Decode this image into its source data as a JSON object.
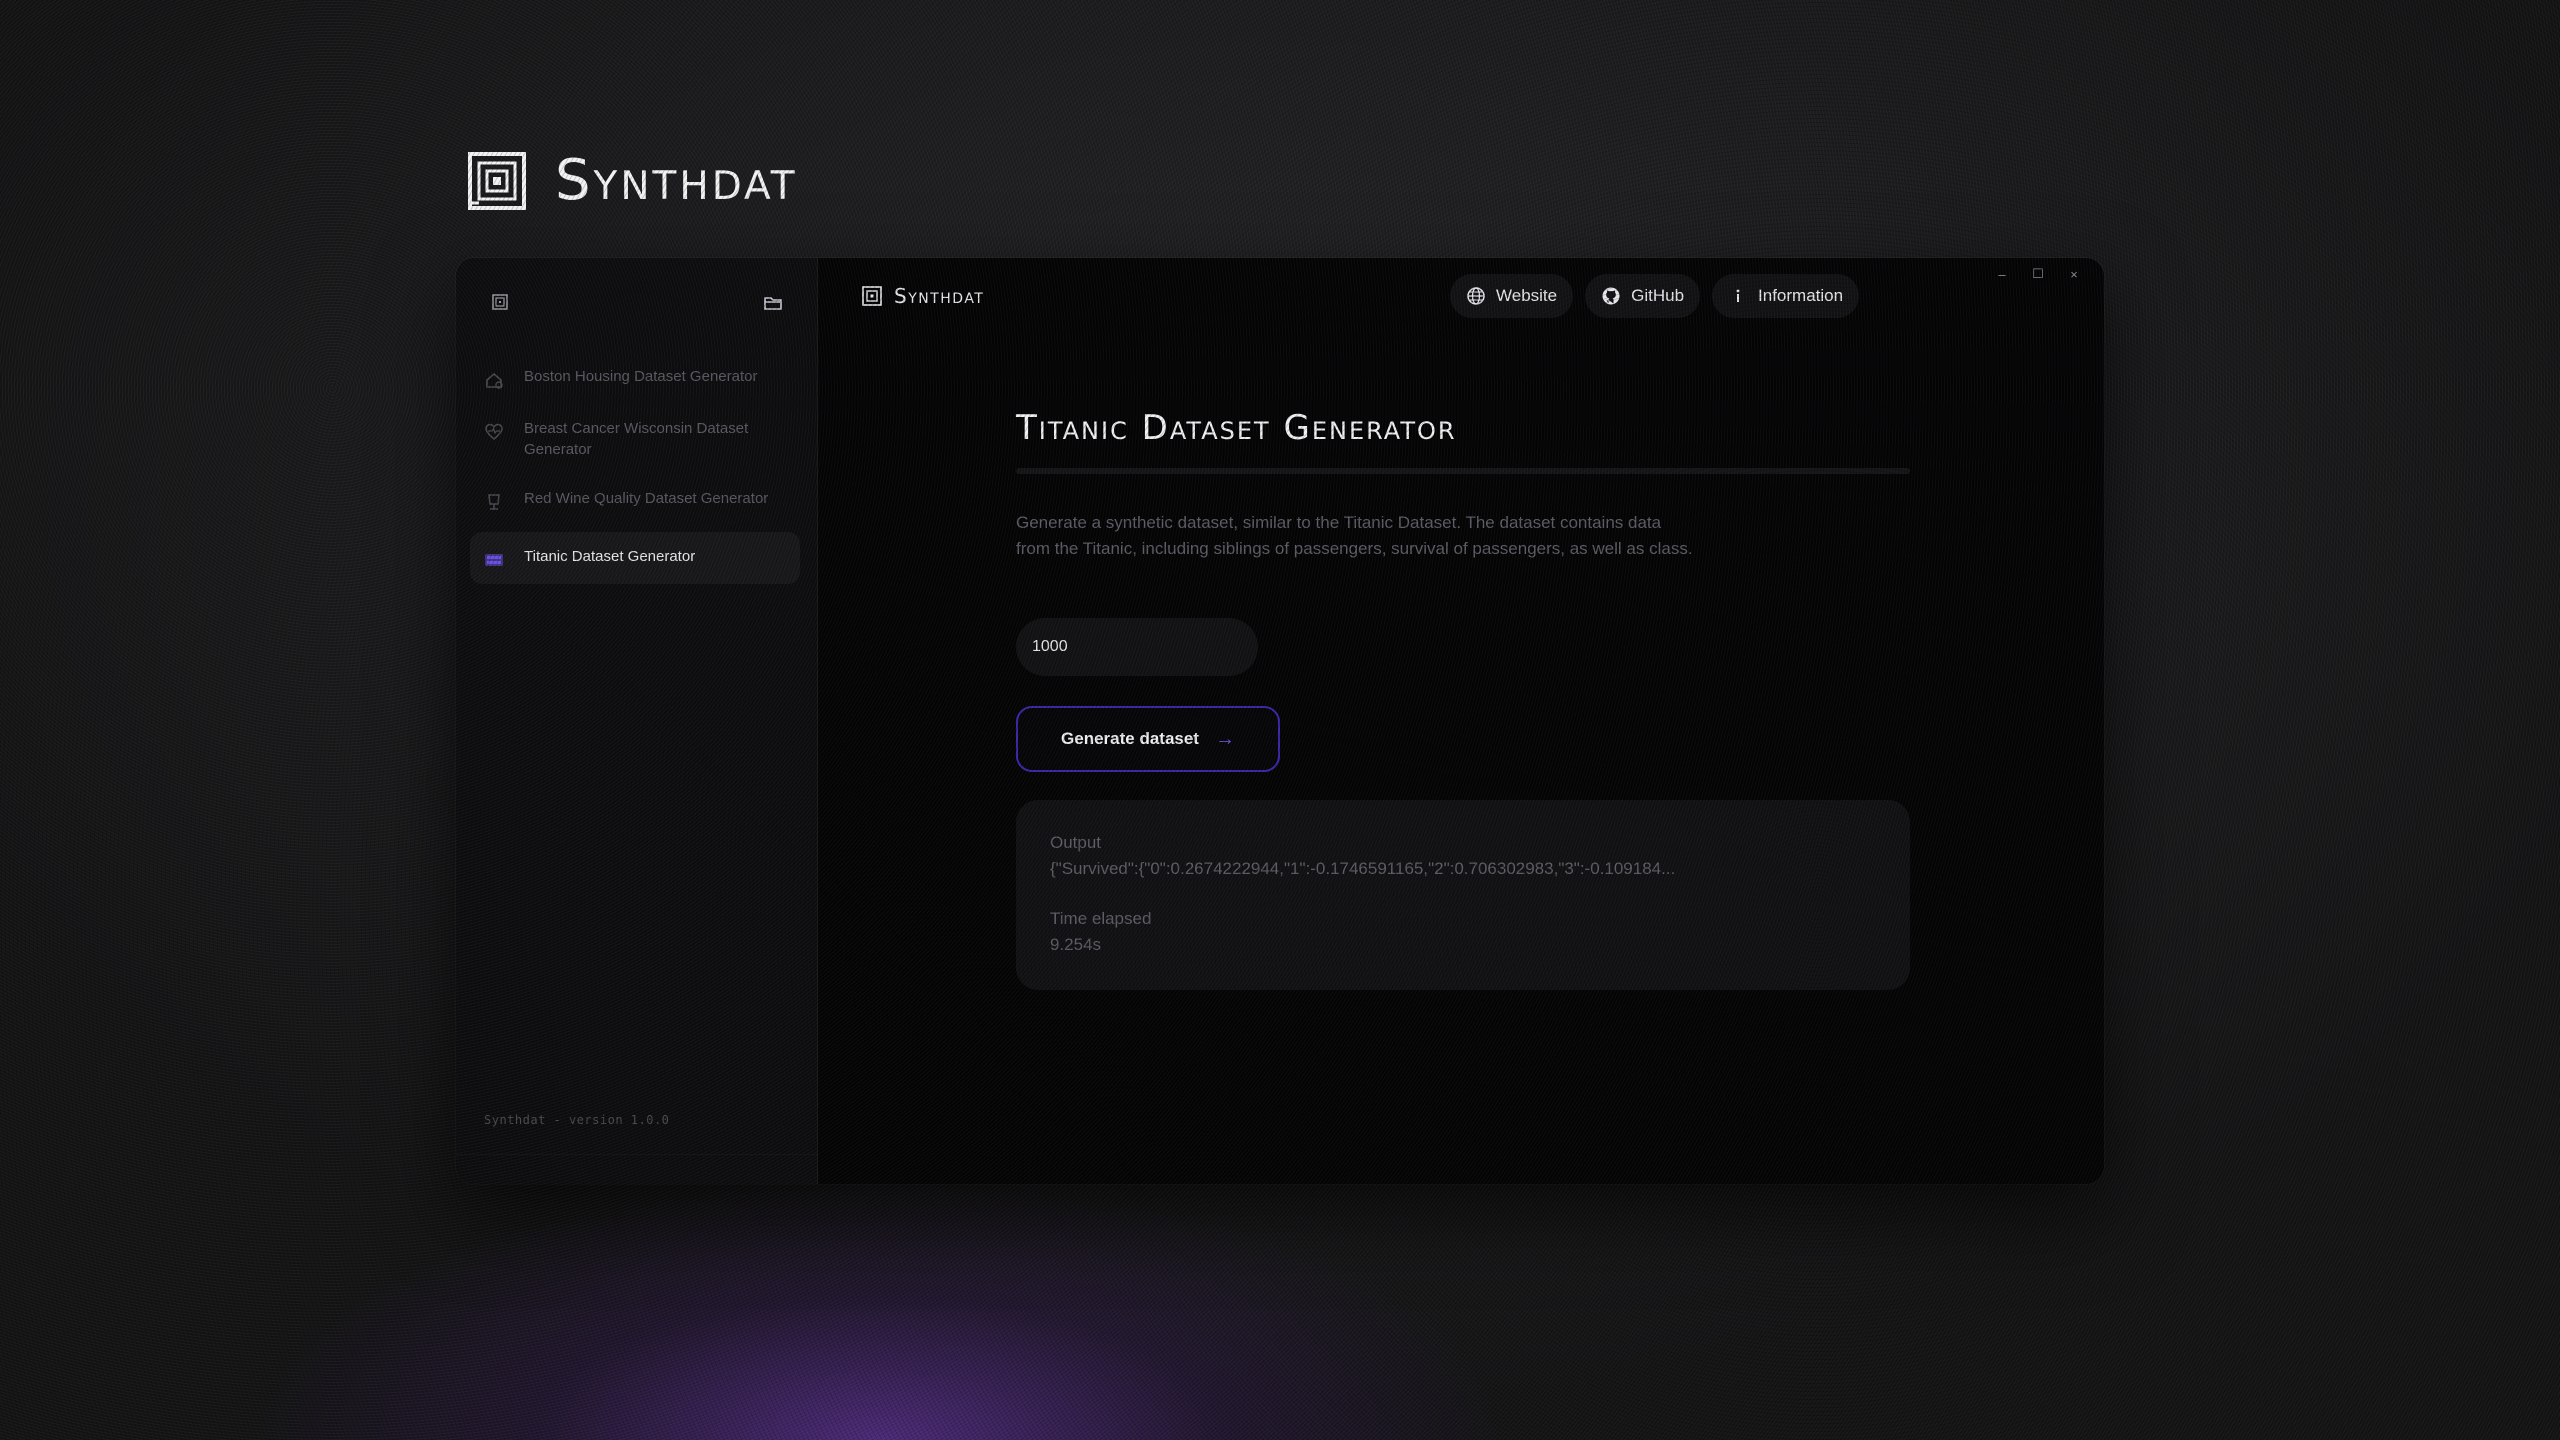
{
  "brand": {
    "name": "Synthdat"
  },
  "sidebar": {
    "items": [
      {
        "label": "Boston Housing Dataset Generator",
        "icon": "house-icon",
        "active": false
      },
      {
        "label": "Breast Cancer Wisconsin Dataset Generator",
        "icon": "heart-pulse-icon",
        "active": false
      },
      {
        "label": "Red Wine Quality Dataset Generator",
        "icon": "wine-glass-icon",
        "active": false
      },
      {
        "label": "Titanic Dataset Generator",
        "icon": "ship-icon",
        "active": true
      }
    ],
    "version": "Synthdat - version 1.0.0"
  },
  "topbar": {
    "title": "Synthdat",
    "website_label": "Website",
    "github_label": "GitHub",
    "information_label": "Information",
    "minimize": "–",
    "maximize": "☐",
    "close": "×"
  },
  "main": {
    "title": "Titanic Dataset Generator",
    "description": "Generate a synthetic dataset, similar to the Titanic Dataset. The dataset contains data from the Titanic, including siblings of passengers, survival of passengers, as well as class.",
    "sample_count": "1000",
    "generate_label": "Generate dataset",
    "output_label": "Output",
    "output_value": "{\"Survived\":{\"0\":0.2674222944,\"1\":-0.1746591165,\"2\":0.706302983,\"3\":-0.109184...",
    "time_label": "Time elapsed",
    "time_value": "9.254s"
  },
  "colors": {
    "accent": "#6a4fe0",
    "button_border": "#3b27a8",
    "window_bg": "#040405",
    "sidebar_bg": "#0d0d0f"
  }
}
